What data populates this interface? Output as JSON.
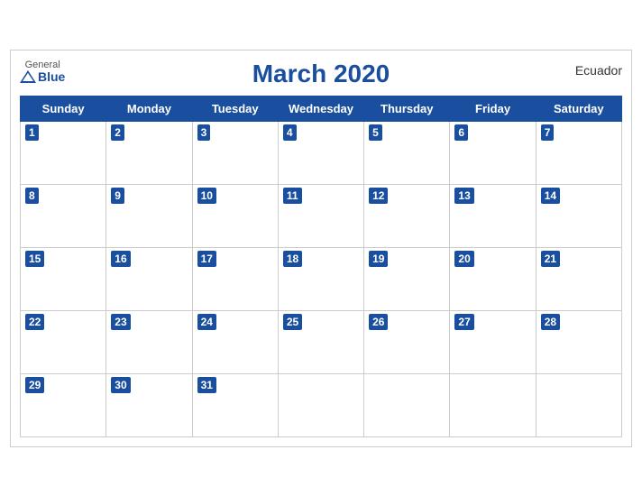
{
  "header": {
    "logo_general": "General",
    "logo_blue": "Blue",
    "title": "March 2020",
    "country": "Ecuador"
  },
  "weekdays": [
    "Sunday",
    "Monday",
    "Tuesday",
    "Wednesday",
    "Thursday",
    "Friday",
    "Saturday"
  ],
  "weeks": [
    [
      {
        "day": 1,
        "active": true
      },
      {
        "day": 2,
        "active": true
      },
      {
        "day": 3,
        "active": true
      },
      {
        "day": 4,
        "active": true
      },
      {
        "day": 5,
        "active": true
      },
      {
        "day": 6,
        "active": true
      },
      {
        "day": 7,
        "active": true
      }
    ],
    [
      {
        "day": 8,
        "active": true
      },
      {
        "day": 9,
        "active": true
      },
      {
        "day": 10,
        "active": true
      },
      {
        "day": 11,
        "active": true
      },
      {
        "day": 12,
        "active": true
      },
      {
        "day": 13,
        "active": true
      },
      {
        "day": 14,
        "active": true
      }
    ],
    [
      {
        "day": 15,
        "active": true
      },
      {
        "day": 16,
        "active": true
      },
      {
        "day": 17,
        "active": true
      },
      {
        "day": 18,
        "active": true
      },
      {
        "day": 19,
        "active": true
      },
      {
        "day": 20,
        "active": true
      },
      {
        "day": 21,
        "active": true
      }
    ],
    [
      {
        "day": 22,
        "active": true
      },
      {
        "day": 23,
        "active": true
      },
      {
        "day": 24,
        "active": true
      },
      {
        "day": 25,
        "active": true
      },
      {
        "day": 26,
        "active": true
      },
      {
        "day": 27,
        "active": true
      },
      {
        "day": 28,
        "active": true
      }
    ],
    [
      {
        "day": 29,
        "active": true
      },
      {
        "day": 30,
        "active": true
      },
      {
        "day": 31,
        "active": true
      },
      {
        "day": null,
        "active": false
      },
      {
        "day": null,
        "active": false
      },
      {
        "day": null,
        "active": false
      },
      {
        "day": null,
        "active": false
      }
    ]
  ]
}
